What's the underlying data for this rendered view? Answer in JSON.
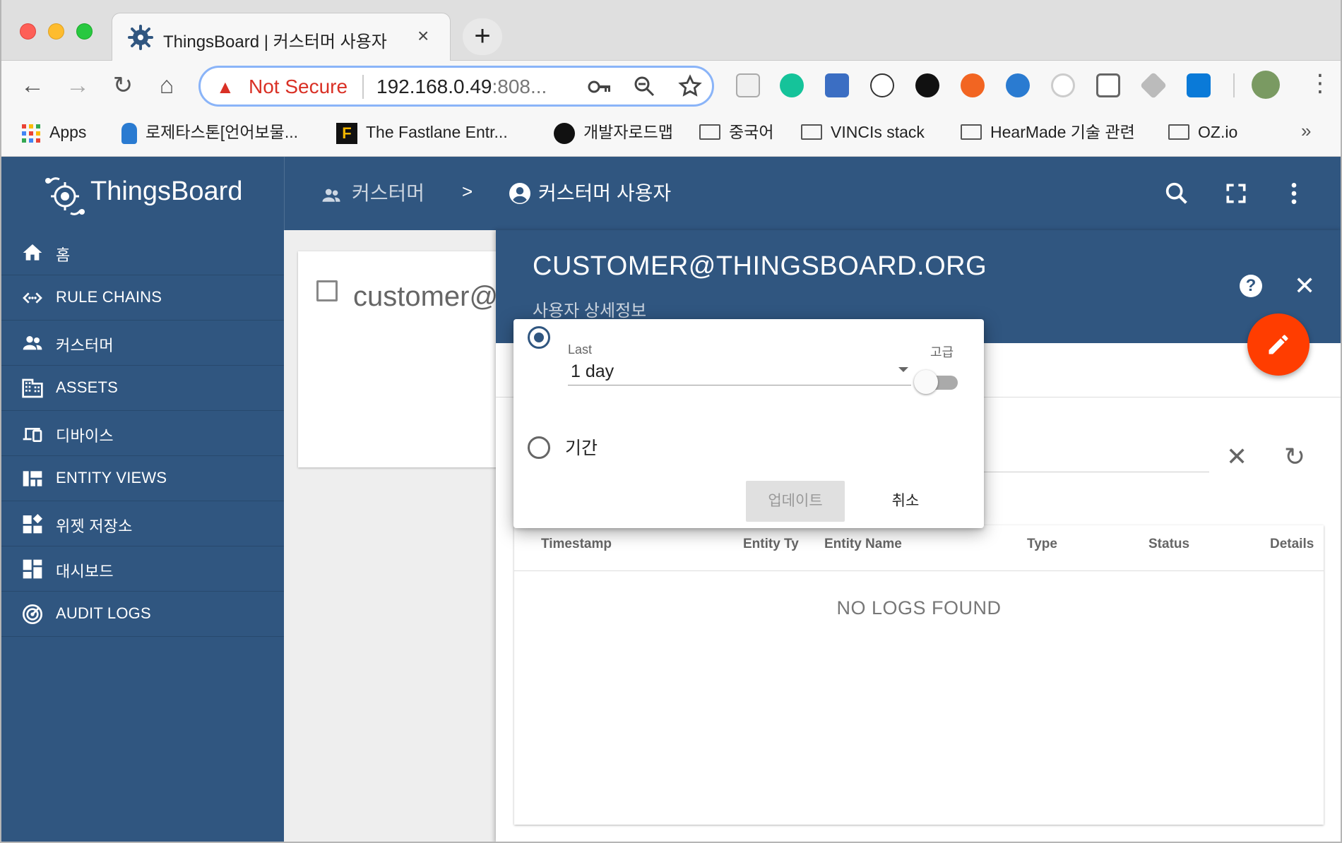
{
  "browser": {
    "tab_title": "ThingsBoard | 커스터머 사용자",
    "tab_close": "×",
    "new_tab": "+",
    "nav": {
      "back": "←",
      "forward": "→",
      "reload": "↻",
      "home": "⌂"
    },
    "omnibox": {
      "security_warning": "▲",
      "security_label": "Not Secure",
      "url_host": "192.168.0.49",
      "url_rest": ":808..."
    },
    "bookmarks": {
      "apps": "Apps",
      "items": [
        "로제타스톤[언어보물...",
        "The Fastlane Entr...",
        "개발자로드맵",
        "중국어",
        "VINCIs stack",
        "HearMade 기술 관련",
        "OZ.io"
      ],
      "more": "»"
    }
  },
  "app": {
    "logo_text": "ThingsBoard",
    "sidebar": [
      {
        "label": "홈",
        "icon": "home-icon"
      },
      {
        "label": "RULE CHAINS",
        "icon": "code-arrows-icon"
      },
      {
        "label": "커스터머",
        "icon": "people-icon"
      },
      {
        "label": "ASSETS",
        "icon": "building-icon"
      },
      {
        "label": "디바이스",
        "icon": "devices-icon"
      },
      {
        "label": "ENTITY VIEWS",
        "icon": "view-quilt-icon"
      },
      {
        "label": "위젯 저장소",
        "icon": "widgets-icon"
      },
      {
        "label": "대시보드",
        "icon": "dashboard-icon"
      },
      {
        "label": "AUDIT LOGS",
        "icon": "track-changes-icon"
      }
    ],
    "breadcrumb": {
      "parent": "커스터머",
      "separator": ">",
      "current": "커스터머 사용자"
    },
    "card": {
      "text": "customer@"
    },
    "detail": {
      "title": "CUSTOMER@THINGSBOARD.ORG",
      "subtitle": "사용자 상세정보",
      "help": "?",
      "close": "✕",
      "search_clear": "✕",
      "refresh": "↻",
      "table": {
        "columns": [
          "Timestamp",
          "Entity Ty",
          "Entity Name",
          "Type",
          "Status",
          "Details"
        ],
        "empty_message": "NO LOGS FOUND"
      }
    },
    "timewindow_popup": {
      "last_label": "Last",
      "advanced_label": "고급",
      "selected_interval": "1 day",
      "period_label": "기간",
      "update_button": "업데이트",
      "cancel_button": "취소"
    }
  },
  "colors": {
    "primary": "#305680",
    "fab": "#ff3d00",
    "warning": "#d93025"
  }
}
